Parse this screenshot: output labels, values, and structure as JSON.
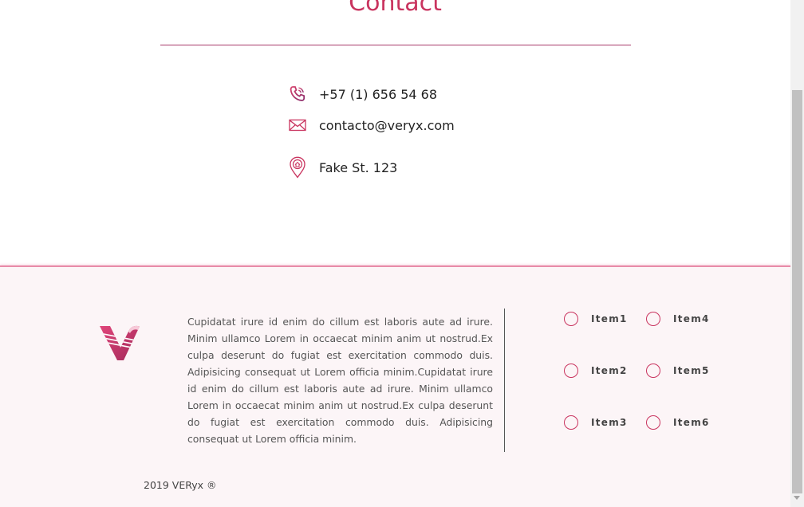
{
  "contact": {
    "title": "Contact",
    "phone": "+57 (1) 656 54 68",
    "email": "contacto@veryx.com",
    "address": "Fake St. 123"
  },
  "footer": {
    "description": "Cupidatat irure id enim do cillum est laboris aute ad irure. Minim ullamco Lorem in occaecat minim anim ut nostrud.Ex culpa deserunt do fugiat est exercitation commodo duis. Adipisicing consequat ut Lorem officia minim.Cupidatat irure id enim do cillum est laboris aute ad irure. Minim ullamco Lorem in occaecat minim anim ut nostrud.Ex culpa deserunt do fugiat est exercitation commodo duis. Adipisicing consequat ut Lorem officia minim.",
    "items": [
      "Item1",
      "Item2",
      "Item3",
      "Item4",
      "Item5",
      "Item6"
    ],
    "copyright": "2019 VERyx ®"
  },
  "colors": {
    "accent": "#c9345f",
    "footer_bg": "#fcf5f7",
    "footer_border": "#e88aa8"
  },
  "icons": {
    "phone": "phone-icon",
    "email": "envelope-icon",
    "address": "location-pin-icon",
    "logo": "v-logo"
  }
}
